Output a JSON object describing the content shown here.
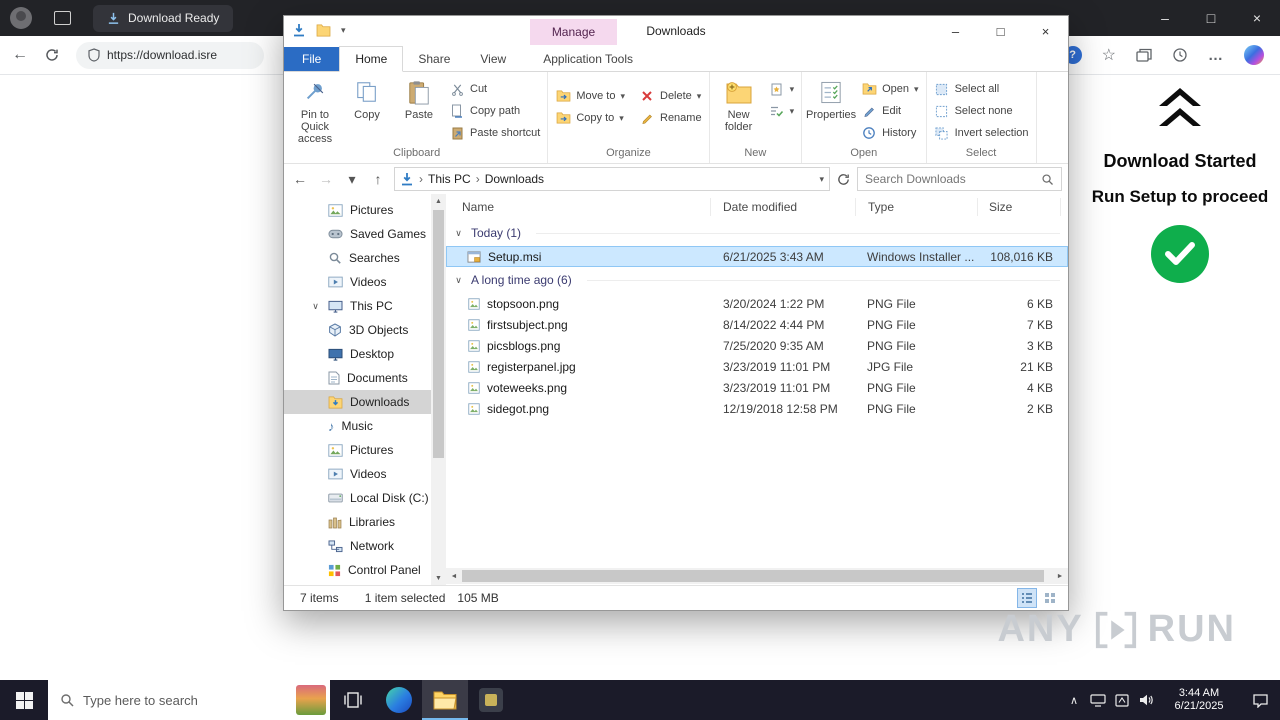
{
  "colors": {
    "accent_blue": "#2b6cc4",
    "manage_pink": "#f5d9ee",
    "selection_blue": "#cce8ff",
    "success_green": "#0fae4c",
    "taskbar_dark": "#1b1b29"
  },
  "icons": {
    "caret_down": "▾",
    "chevron_right": "›",
    "chevron_down": "∨",
    "chevron_up": "∧",
    "arrow_back": "←",
    "arrow_forward": "→",
    "arrow_up": "↑",
    "scroll_up": "▲",
    "scroll_down": "▼",
    "scroll_left": "◄",
    "scroll_right": "►",
    "minimize": "–",
    "maximize": "□",
    "close": "×",
    "ellipsis": "…",
    "star": "☆",
    "question": "?",
    "music_note": "♪"
  },
  "browser": {
    "tab_title": "Download Ready",
    "url": "https://download.isre"
  },
  "page": {
    "title": "Download Started",
    "subtitle": "Run Setup to proceed"
  },
  "explorer": {
    "window_title": "Downloads",
    "manage_label": "Manage",
    "tabs": [
      "File",
      "Home",
      "Share",
      "View",
      "Application Tools"
    ],
    "ribbon": {
      "clipboard": {
        "label": "Clipboard",
        "pin": "Pin to Quick access",
        "copy": "Copy",
        "paste": "Paste",
        "cut": "Cut",
        "copy_path": "Copy path",
        "paste_shortcut": "Paste shortcut"
      },
      "organize": {
        "label": "Organize",
        "move_to": "Move to",
        "copy_to": "Copy to",
        "delete": "Delete",
        "rename": "Rename"
      },
      "new_group": {
        "label": "New",
        "new_folder": "New folder"
      },
      "open_group": {
        "label": "Open",
        "properties": "Properties",
        "open": "Open",
        "edit": "Edit",
        "history": "History"
      },
      "select_group": {
        "label": "Select",
        "select_all": "Select all",
        "select_none": "Select none",
        "invert": "Invert selection"
      }
    },
    "address": {
      "root": "This PC",
      "leaf": "Downloads",
      "search_placeholder": "Search Downloads"
    },
    "sidebar": [
      {
        "label": "Pictures"
      },
      {
        "label": "Saved Games"
      },
      {
        "label": "Searches"
      },
      {
        "label": "Videos"
      },
      {
        "label": "This PC"
      },
      {
        "label": "3D Objects"
      },
      {
        "label": "Desktop"
      },
      {
        "label": "Documents"
      },
      {
        "label": "Downloads"
      },
      {
        "label": "Music"
      },
      {
        "label": "Pictures"
      },
      {
        "label": "Videos"
      },
      {
        "label": "Local Disk (C:)"
      },
      {
        "label": "Libraries"
      },
      {
        "label": "Network"
      },
      {
        "label": "Control Panel"
      }
    ],
    "columns": [
      "Name",
      "Date modified",
      "Type",
      "Size"
    ],
    "groups": [
      {
        "label": "Today (1)",
        "rows": [
          {
            "name": "Setup.msi",
            "date": "6/21/2025 3:43 AM",
            "type": "Windows Installer ...",
            "size": "108,016 KB"
          }
        ]
      },
      {
        "label": "A long time ago (6)",
        "rows": [
          {
            "name": "stopsoon.png",
            "date": "3/20/2024 1:22 PM",
            "type": "PNG File",
            "size": "6 KB"
          },
          {
            "name": "firstsubject.png",
            "date": "8/14/2022 4:44 PM",
            "type": "PNG File",
            "size": "7 KB"
          },
          {
            "name": "picsblogs.png",
            "date": "7/25/2020 9:35 AM",
            "type": "PNG File",
            "size": "3 KB"
          },
          {
            "name": "registerpanel.jpg",
            "date": "3/23/2019 11:01 PM",
            "type": "JPG File",
            "size": "21 KB"
          },
          {
            "name": "voteweeks.png",
            "date": "3/23/2019 11:01 PM",
            "type": "PNG File",
            "size": "4 KB"
          },
          {
            "name": "sidegot.png",
            "date": "12/19/2018 12:58 PM",
            "type": "PNG File",
            "size": "2 KB"
          }
        ]
      }
    ],
    "status": {
      "count": "7 items",
      "selected": "1 item selected",
      "size": "105 MB"
    }
  },
  "taskbar": {
    "search_placeholder": "Type here to search",
    "time": "3:44 AM",
    "date": "6/21/2025"
  },
  "watermark": {
    "left": "ANY",
    "right": "RUN"
  }
}
